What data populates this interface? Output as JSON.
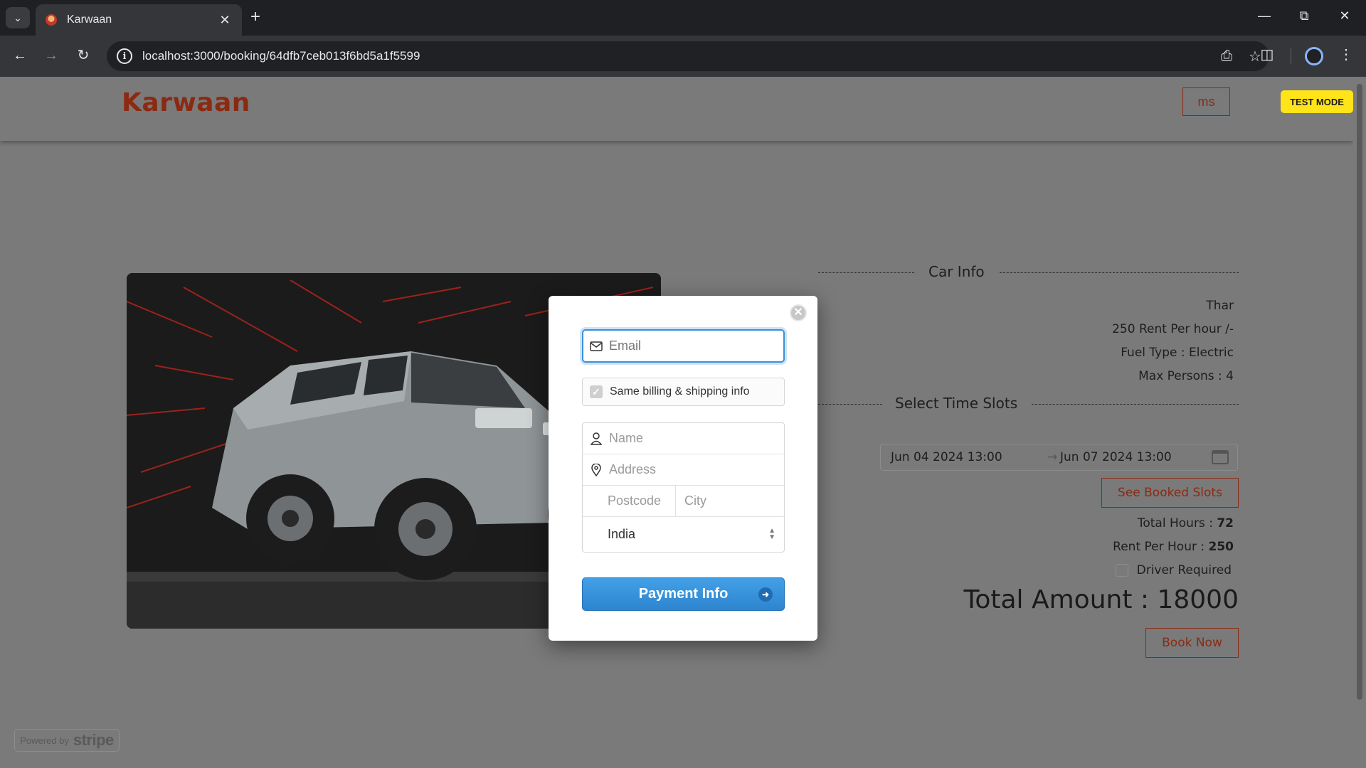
{
  "browser": {
    "tab_title": "Karwaan",
    "url": "localhost:3000/booking/64dfb7ceb013f6bd5a1f5599"
  },
  "site": {
    "brand": "Karwaan",
    "user_button": "ms",
    "test_mode": "TEST MODE"
  },
  "car_info": {
    "section_title": "Car Info",
    "name": "Thar",
    "rent_line": "250 Rent Per hour /-",
    "fuel_line": "Fuel Type : Electric",
    "persons_line": "Max Persons : 4"
  },
  "time_slots": {
    "section_title": "Select Time Slots",
    "start": "Jun 04 2024 13:00",
    "end": "Jun 07 2024 13:00",
    "see_booked_slots": "See Booked Slots",
    "total_hours_label": "Total Hours : ",
    "total_hours": "72",
    "rent_per_hour_label": "Rent Per Hour : ",
    "rent_per_hour": "250",
    "driver_required": "Driver Required",
    "total_amount": "Total Amount : 18000",
    "book_now": "Book Now"
  },
  "checkout": {
    "email_placeholder": "Email",
    "same_info_label": "Same billing & shipping info",
    "same_info_checked": true,
    "name_placeholder": "Name",
    "address_placeholder": "Address",
    "postcode_placeholder": "Postcode",
    "city_placeholder": "City",
    "country": "India",
    "payment_button": "Payment Info"
  },
  "stripe_badge": {
    "powered_by": "Powered by",
    "brand": "stripe"
  },
  "colors": {
    "brand_accent": "#8b2a12",
    "test_mode_bg": "#ffe419",
    "pay_button": "#2d85cf"
  }
}
